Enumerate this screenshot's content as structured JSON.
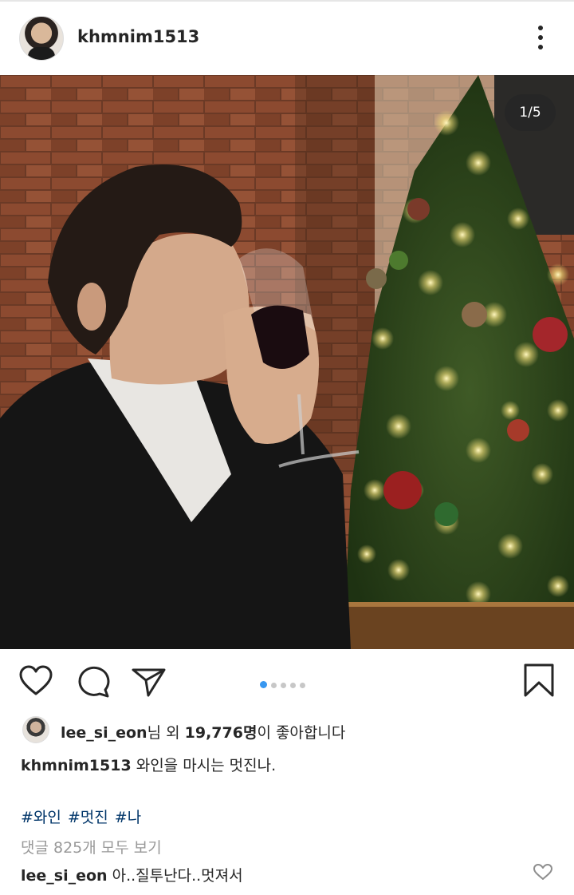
{
  "post": {
    "username": "khmnim1513",
    "image_counter": "1/5",
    "carousel": {
      "count": 5,
      "active_index": 0
    }
  },
  "likes": {
    "liker": "lee_si_eon",
    "middle": "님 외 ",
    "count": "19,776명",
    "suffix": "이 좋아합니다"
  },
  "caption": {
    "username": "khmnim1513",
    "text": " 와인을 마시는 멋진나."
  },
  "hashtags": [
    "#와인",
    "#멋진",
    "#나"
  ],
  "view_comments": "댓글 825개 모두 보기",
  "comment": {
    "username": "lee_si_eon",
    "text": " 아..질투난다..멋져서"
  },
  "icons": {
    "more": "more-vertical-icon",
    "like": "heart-icon",
    "comment": "comment-icon",
    "share": "send-icon",
    "save": "bookmark-icon",
    "comment_like": "heart-icon"
  },
  "colors": {
    "text": "#262626",
    "hashtag": "#003569",
    "muted": "#999999",
    "carousel_active": "#3897f0",
    "carousel_inactive": "#c7c7c7"
  }
}
